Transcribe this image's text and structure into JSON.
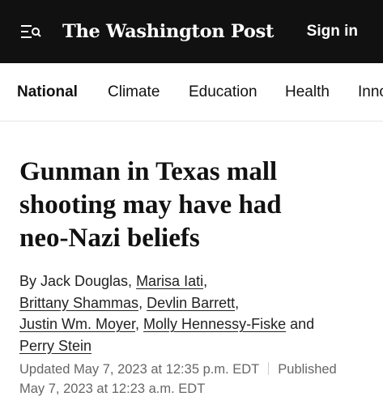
{
  "header": {
    "logo_text": "The Washington Post",
    "sign_in_label": "Sign in",
    "menu_icon": "menu-icon"
  },
  "nav": {
    "items": [
      {
        "label": "National",
        "active": true
      },
      {
        "label": "Climate"
      },
      {
        "label": "Education"
      },
      {
        "label": "Health"
      },
      {
        "label": "Inno"
      }
    ]
  },
  "article": {
    "headline_lines": [
      "Gunman in Texas mall",
      "shooting may have had",
      "neo-Nazi beliefs"
    ],
    "byline": {
      "prefix": "By Jack Douglas, ",
      "authors": [
        "Marisa Iati",
        "Brittany Shammas",
        "Devlin Barrett",
        "Justin Wm. Moyer",
        "Molly Hennessy-Fiske",
        "Perry Stein"
      ],
      "comma": ",",
      "comma_space": ", ",
      "and_word": " and"
    },
    "updated": "Updated May 7, 2023 at 12:35 p.m. EDT",
    "published_label": "Published",
    "published": "May 7, 2023 at 12:23 a.m. EDT"
  },
  "colors": {
    "header_bg": "#111111",
    "text": "#111111",
    "meta_text": "#666666"
  }
}
